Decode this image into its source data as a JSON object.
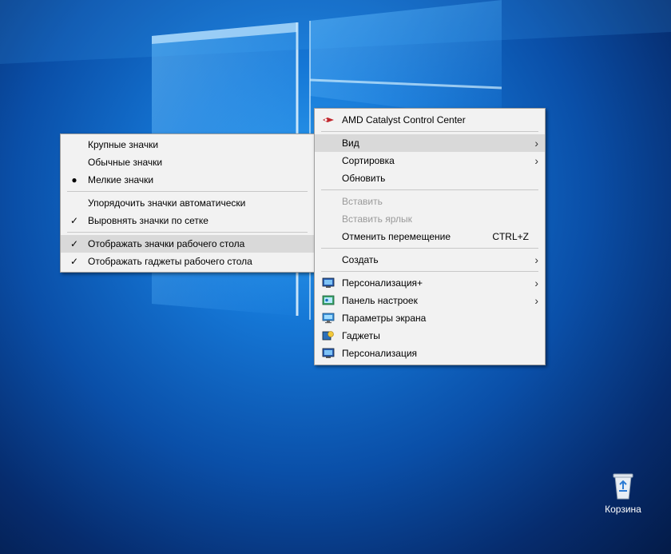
{
  "desktop": {
    "recycle_bin_label": "Корзина"
  },
  "view_submenu": {
    "items": [
      {
        "label": "Крупные значки",
        "mark": ""
      },
      {
        "label": "Обычные значки",
        "mark": ""
      },
      {
        "label": "Мелкие значки",
        "mark": "●"
      },
      {
        "label": "Упорядочить значки автоматически",
        "mark": ""
      },
      {
        "label": "Выровнять значки по сетке",
        "mark": "✓"
      },
      {
        "label": "Отображать значки рабочего стола",
        "mark": "✓"
      },
      {
        "label": "Отображать гаджеты  рабочего стола",
        "mark": "✓"
      }
    ]
  },
  "context_menu": {
    "amd": "AMD Catalyst Control Center",
    "view": "Вид",
    "sort": "Сортировка",
    "refresh": "Обновить",
    "paste": "Вставить",
    "paste_shortcut": "Вставить ярлык",
    "undo_move": "Отменить перемещение",
    "undo_shortcut": "CTRL+Z",
    "create": "Создать",
    "personalization_plus": "Персонализация+",
    "settings_panel": "Панель настроек",
    "display_settings": "Параметры экрана",
    "gadgets": "Гаджеты",
    "personalization": "Персонализация"
  },
  "colors": {
    "menu_bg": "#f2f2f2",
    "highlight": "#d9d9d9",
    "desktop_blue": "#1577d6"
  }
}
